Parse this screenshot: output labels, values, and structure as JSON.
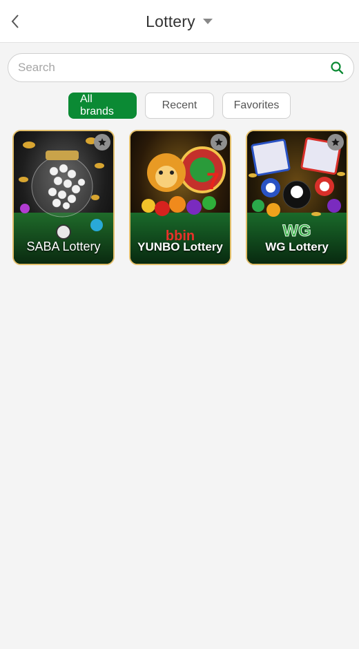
{
  "header": {
    "title": "Lottery",
    "back_icon": "chevron-left-icon",
    "dropdown_icon": "caret-down-icon"
  },
  "search": {
    "placeholder": "Search",
    "value": "",
    "icon": "search-icon"
  },
  "filters": [
    {
      "label": "All brands",
      "active": true
    },
    {
      "label": "Recent",
      "active": false
    },
    {
      "label": "Favorites",
      "active": false
    }
  ],
  "games": [
    {
      "name": "SABA Lottery",
      "favorite_icon": "star-icon"
    },
    {
      "name": "YUNBO Lottery",
      "favorite_icon": "star-icon"
    },
    {
      "name": "WG Lottery",
      "favorite_icon": "star-icon"
    }
  ],
  "colors": {
    "accent": "#0b8a34",
    "card_border": "#e3bf6a",
    "page_bg": "#f4f4f4"
  }
}
